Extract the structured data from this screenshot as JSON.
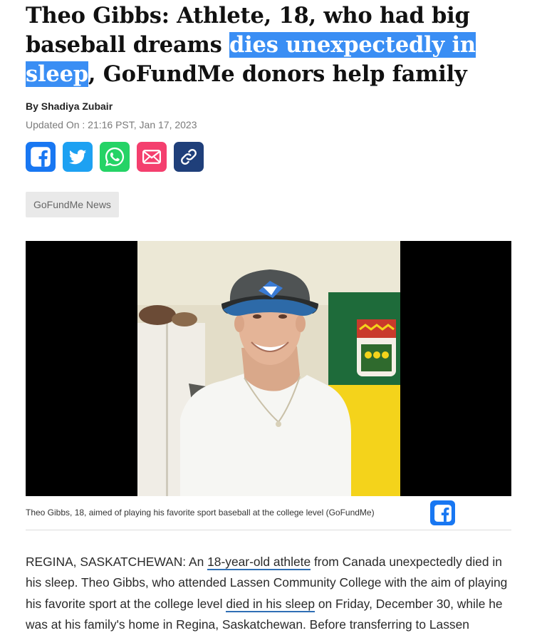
{
  "article": {
    "headline_before": "Theo Gibbs: Athlete, 18, who had big baseball dreams ",
    "headline_highlight": "dies unexpectedly in sleep",
    "headline_after": ", GoFundMe donors help family",
    "byline": "By Shadiya Zubair",
    "updated": "Updated On : 21:16 PST, Jan 17, 2023",
    "tag": "GoFundMe News",
    "caption": "Theo Gibbs, 18, aimed of playing his favorite sport baseball at the college level (GoFundMe)",
    "body": {
      "p1_a": "REGINA, SASKATCHEWAN: An ",
      "p1_link1": "18-year-old athlete",
      "p1_b": " from Canada unexpectedly died in his sleep. Theo Gibbs, who attended Lassen Community College with the aim of playing his favorite sport at the college level ",
      "p1_link2": "died in his sleep",
      "p1_c": " on Friday, December 30, while he was at his family's home in Regina, Saskatchewan. Before transferring to Lassen"
    }
  },
  "share": {
    "buttons": [
      {
        "icon": "facebook-icon",
        "color": "#1877f2"
      },
      {
        "icon": "twitter-icon",
        "color": "#1da1f2"
      },
      {
        "icon": "whatsapp-icon",
        "color": "#25d366"
      },
      {
        "icon": "email-icon",
        "color": "#f43f6e"
      },
      {
        "icon": "link-icon",
        "color": "#1f3f7a"
      }
    ]
  },
  "colors": {
    "highlight": "#3a8ef4",
    "link_underline": "#2f6fb5"
  }
}
